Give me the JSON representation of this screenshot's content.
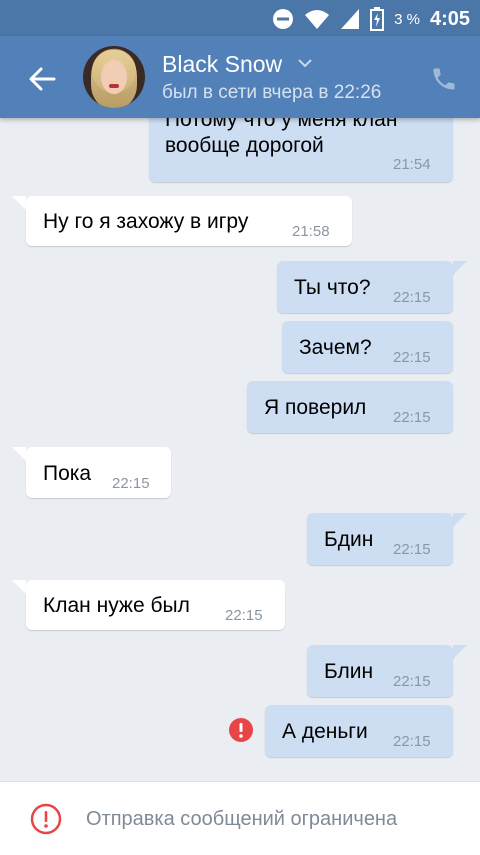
{
  "status_bar": {
    "battery_percent": "3 %",
    "time": "4:05"
  },
  "header": {
    "name": "Black Snow",
    "status": "был в сети вчера в 22:26"
  },
  "messages": [
    {
      "text": "Потому что у меня клан",
      "text2": "вообще дорогой",
      "time": "21:54"
    },
    {
      "text": "Ну го я захожу в игру",
      "time": "21:58"
    },
    {
      "text": "Ты что?",
      "time": "22:15"
    },
    {
      "text": "Зачем?",
      "time": "22:15"
    },
    {
      "text": "Я поверил",
      "time": "22:15"
    },
    {
      "text": "Пока",
      "time": "22:15"
    },
    {
      "text": "Бдин",
      "time": "22:15"
    },
    {
      "text": "Клан нуже был",
      "time": "22:15"
    },
    {
      "text": "Блин",
      "time": "22:15"
    },
    {
      "text": "А деньги",
      "time": "22:15"
    }
  ],
  "bottom_bar": {
    "notice": "Отправка сообщений ограничена"
  },
  "colors": {
    "header": "#5181b8",
    "outgoing_bubble": "#cddef3",
    "error": "#e64646"
  }
}
